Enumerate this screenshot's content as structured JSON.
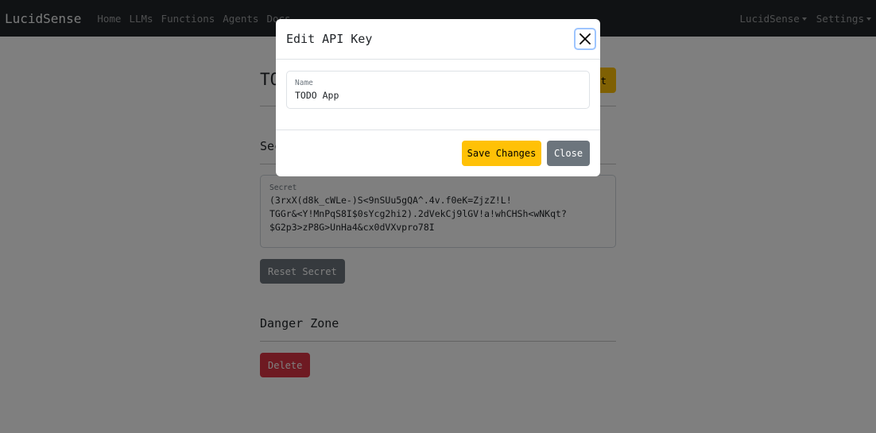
{
  "navbar": {
    "brand": "LucidSense",
    "links": [
      "Home",
      "LLMs",
      "Functions",
      "Agents",
      "Docs"
    ],
    "right": [
      "LucidSense",
      "Settings"
    ]
  },
  "page": {
    "title": "TODO App",
    "edit_label": "Edit",
    "secret_section_title": "Secret",
    "secret_label": "Secret",
    "secret_value": "(3rxX(d8k_cWLe-)S<9nSUu5gQA^.4v.f0eK=ZjzZ!L!\nTGGr&<Y!MnPqS8I$0sYcg2hi2).2dVekCj9lGV!a!whCHSh<wNKqt?\n$G2p3>zP8G>UnHa4&cx0dVXvpro78I",
    "reset_label": "Reset Secret",
    "danger_title": "Danger Zone",
    "delete_label": "Delete"
  },
  "modal": {
    "title": "Edit API Key",
    "name_label": "Name",
    "name_value": "TODO App",
    "save_label": "Save Changes",
    "close_label": "Close"
  },
  "colors": {
    "navbar": "#212529",
    "warning": "#ffc107",
    "secondary": "#6c757d",
    "danger": "#dc3545",
    "focus_ring": "#9ec5fe"
  },
  "icons": {
    "close": "close-icon",
    "dropdown": "caret-down-icon"
  }
}
